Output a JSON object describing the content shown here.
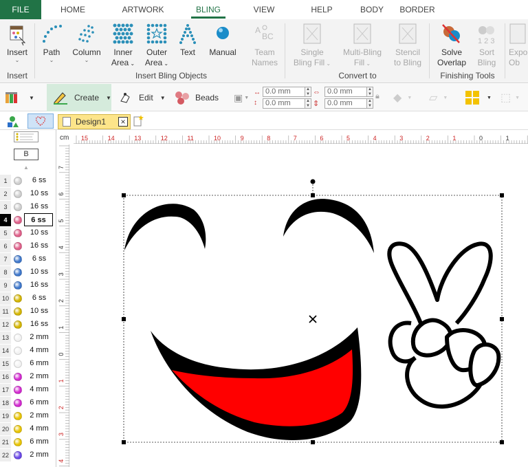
{
  "tabs": [
    "FILE",
    "HOME",
    "ARTWORK",
    "BLING",
    "VIEW",
    "HELP",
    "BODY",
    "BORDER"
  ],
  "active_tab": "BLING",
  "ribbon": {
    "insert": {
      "label": "Insert",
      "group": "Insert"
    },
    "path": "Path",
    "column": "Column",
    "inner_area": [
      "Inner",
      "Area"
    ],
    "outer_area": [
      "Outer",
      "Area"
    ],
    "text": "Text",
    "manual": "Manual",
    "team_names": [
      "Team",
      "Names"
    ],
    "insert_bling_group": "Insert Bling Objects",
    "single_bling_fill": [
      "Single",
      "Bling Fill"
    ],
    "multi_bling_fill": [
      "Multi-Bling",
      "Fill"
    ],
    "stencil_to_bling": [
      "Stencil",
      "to Bling"
    ],
    "convert_group": "Convert to",
    "solve_overlap": [
      "Solve",
      "Overlap"
    ],
    "sort_bling": [
      "Sort",
      "Bling"
    ],
    "finishing_group": "Finishing Tools",
    "export_partial": [
      "Expo",
      "Ob"
    ]
  },
  "toolbar": {
    "create": "Create",
    "edit": "Edit",
    "beads": "Beads",
    "x_value": "0.0 mm",
    "y_value": "0.0 mm",
    "w_value": "0.0 mm",
    "h_value": "0.0 mm"
  },
  "document": {
    "tab": "Design1",
    "unit": "cm"
  },
  "palette": {
    "header_letter": "B",
    "rows": [
      {
        "n": "1",
        "size": "6 ss",
        "color": "#cfcfcf"
      },
      {
        "n": "2",
        "size": "10 ss",
        "color": "#cfcfcf"
      },
      {
        "n": "3",
        "size": "16 ss",
        "color": "#cfcfcf"
      },
      {
        "n": "4",
        "size": "6 ss",
        "color": "#e0608a"
      },
      {
        "n": "5",
        "size": "10 ss",
        "color": "#e0608a"
      },
      {
        "n": "6",
        "size": "16 ss",
        "color": "#e0608a"
      },
      {
        "n": "7",
        "size": "6 ss",
        "color": "#3f78cc"
      },
      {
        "n": "8",
        "size": "10 ss",
        "color": "#3f78cc"
      },
      {
        "n": "9",
        "size": "16 ss",
        "color": "#3f78cc"
      },
      {
        "n": "10",
        "size": "6 ss",
        "color": "#d4b500"
      },
      {
        "n": "11",
        "size": "10 ss",
        "color": "#d4b500"
      },
      {
        "n": "12",
        "size": "16 ss",
        "color": "#d4b500"
      },
      {
        "n": "13",
        "size": "2 mm",
        "color": "#f2f2f2"
      },
      {
        "n": "14",
        "size": "4 mm",
        "color": "#f2f2f2"
      },
      {
        "n": "15",
        "size": "6 mm",
        "color": "#f2f2f2"
      },
      {
        "n": "16",
        "size": "2 mm",
        "color": "#d32ad0"
      },
      {
        "n": "17",
        "size": "4 mm",
        "color": "#d32ad0"
      },
      {
        "n": "18",
        "size": "6 mm",
        "color": "#d32ad0"
      },
      {
        "n": "19",
        "size": "2 mm",
        "color": "#e8c400"
      },
      {
        "n": "20",
        "size": "4 mm",
        "color": "#e8c400"
      },
      {
        "n": "21",
        "size": "6 mm",
        "color": "#e8c400"
      },
      {
        "n": "22",
        "size": "2 mm",
        "color": "#6a48e8"
      }
    ],
    "selected_row": "4"
  },
  "ruler_h_labels": [
    "15",
    "14",
    "13",
    "12",
    "11",
    "10",
    "9",
    "8",
    "7",
    "6",
    "5",
    "4",
    "3",
    "2",
    "1",
    "0",
    "1"
  ],
  "ruler_v_labels": [
    "7",
    "6",
    "5",
    "4",
    "3",
    "2",
    "1",
    "0",
    "1",
    "2",
    "3",
    "4"
  ],
  "colors": {
    "accent": "#217346",
    "mouth_fill": "#ff0000",
    "outline": "#000000"
  }
}
